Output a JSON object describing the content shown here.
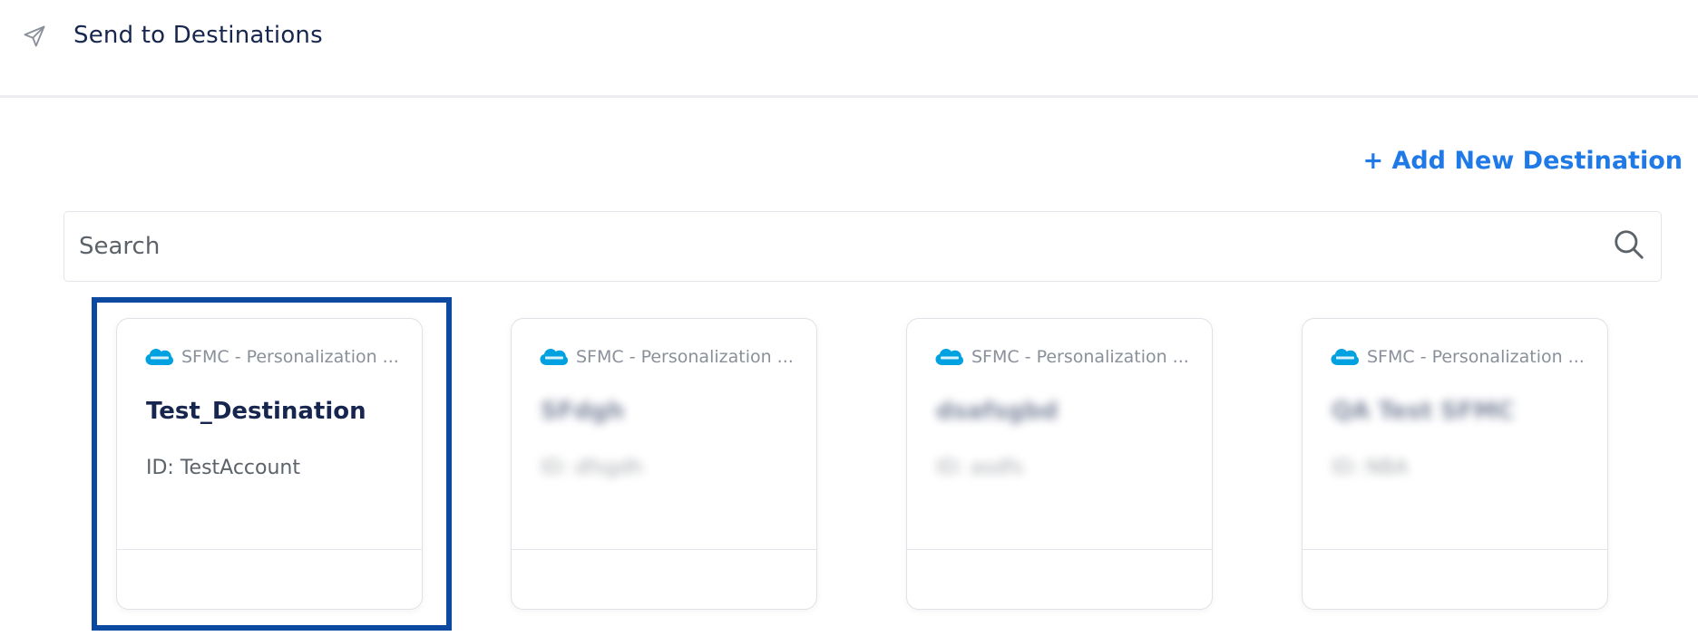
{
  "header": {
    "icon": "send-icon",
    "title": "Send to Destinations"
  },
  "add_destination_label": "+ Add New Destination",
  "search": {
    "placeholder": "Search",
    "value": "",
    "icon": "search-icon"
  },
  "colors": {
    "accent": "#1f7ae8",
    "title": "#17264f",
    "selection": "#0b4aa0",
    "salesforce": "#00a1e0"
  },
  "cards": [
    {
      "type": "SFMC - Personalization ...",
      "name": "Test_Destination",
      "id_text": "ID: TestAccount",
      "selected": true,
      "blurred": false
    },
    {
      "type": "SFMC - Personalization ...",
      "name": "SFdgh",
      "id_text": "ID: dfsgdh",
      "selected": false,
      "blurred": true
    },
    {
      "type": "SFMC - Personalization ...",
      "name": "dsafsgbd",
      "id_text": "ID: asdfs",
      "selected": false,
      "blurred": true
    },
    {
      "type": "SFMC - Personalization ...",
      "name": "QA Test SFMC",
      "id_text": "ID: NBA",
      "selected": false,
      "blurred": true
    }
  ]
}
